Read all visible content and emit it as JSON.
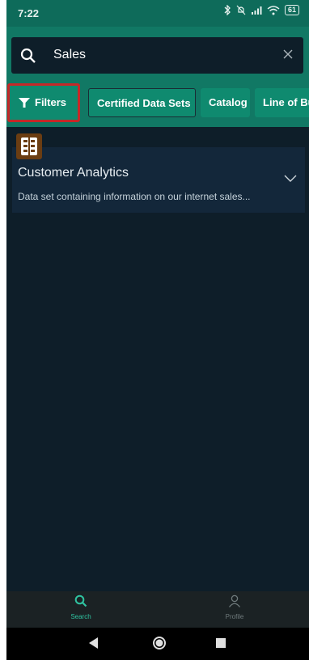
{
  "status_bar": {
    "time": "7:22",
    "battery": "61"
  },
  "search": {
    "value": "Sales"
  },
  "chips": [
    {
      "label": "Filters"
    },
    {
      "label": "Certified Data Sets"
    },
    {
      "label": "Catalog"
    },
    {
      "label": "Line of Bu"
    }
  ],
  "result": {
    "title": "Customer Analytics",
    "description": "Data set containing information on our internet sales..."
  },
  "bottom_nav": {
    "search_label": "Search",
    "profile_label": "Profile"
  },
  "colors": {
    "header": "#117864",
    "chip": "#0f8a6f",
    "background": "#0e1e29",
    "card": "#13273a",
    "highlight": "#c62828",
    "accent": "#2fc2a0"
  },
  "icons": [
    "search-icon",
    "close-icon",
    "filter-icon",
    "dataset-icon",
    "chevron-down-icon",
    "profile-icon",
    "back-icon",
    "home-icon",
    "recents-icon"
  ]
}
